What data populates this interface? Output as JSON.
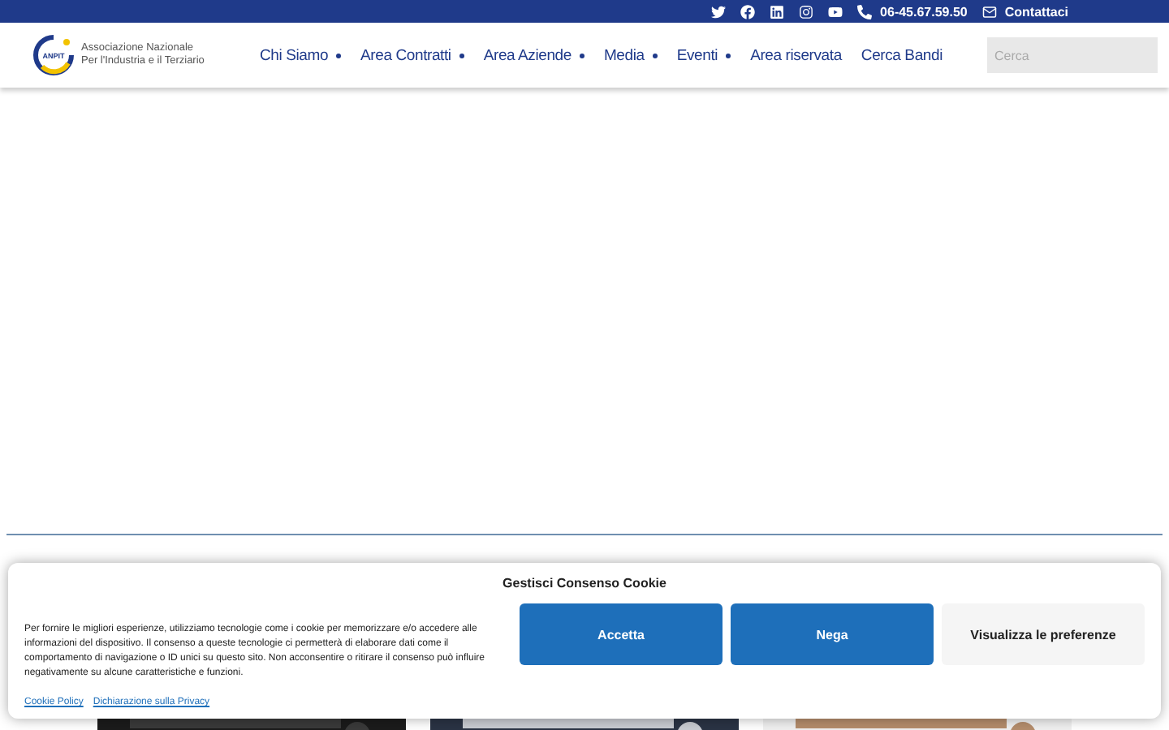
{
  "top_bar": {
    "phone": "06-45.67.59.50",
    "contact": "Contattaci"
  },
  "header": {
    "logo_mark": "ANPIT",
    "logo_lines": [
      "Associazione Nazionale",
      "Per l'Industria e il Terziario"
    ],
    "nav": [
      {
        "label": "Chi Siamo",
        "dropdown": true
      },
      {
        "label": "Area Contratti",
        "dropdown": true
      },
      {
        "label": "Area Aziende",
        "dropdown": true
      },
      {
        "label": "Media",
        "dropdown": true
      },
      {
        "label": "Eventi",
        "dropdown": true
      },
      {
        "label": "Area riservata",
        "dropdown": false
      },
      {
        "label": "Cerca Bandi",
        "dropdown": false
      }
    ],
    "search": {
      "placeholder": "Cerca"
    }
  },
  "cookie_banner": {
    "title": "Gestisci Consenso Cookie",
    "text": "Per fornire le migliori esperienze, utilizziamo tecnologie come i cookie per memorizzare e/o accedere alle informazioni del dispositivo. Il consenso a queste tecnologie ci permetterà di elaborare dati come il comportamento di navigazione o ID unici su questo sito. Non acconsentire o ritirare il consenso può influire negativamente su alcune caratteristiche e funzioni.",
    "links": [
      "Cookie Policy",
      "Dichiarazione sulla Privacy"
    ],
    "buttons": [
      {
        "label": "Accetta",
        "kind": "primary"
      },
      {
        "label": "Nega",
        "kind": "primary"
      },
      {
        "label": "Visualizza le preferenze",
        "kind": "secondary"
      }
    ]
  }
}
